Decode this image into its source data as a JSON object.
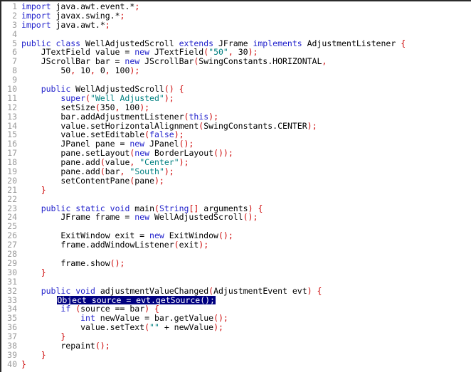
{
  "editor": {
    "language": "java",
    "total_lines": 40,
    "selected_line": 33,
    "colors": {
      "background": "#ffffff",
      "text": "#000000",
      "keyword": "#2222cc",
      "string": "#008080",
      "punctuation": "#cc0000",
      "line_number": "#9a9a9a",
      "selection_background": "#000080",
      "selection_text": "#ffffff",
      "border": "#2b2b2b"
    }
  },
  "lines": [
    {
      "n": "1",
      "tokens": [
        {
          "t": "kw",
          "v": "import"
        },
        {
          "t": "id",
          "v": " java"
        },
        {
          "t": "id",
          "v": "."
        },
        {
          "t": "id",
          "v": "awt"
        },
        {
          "t": "id",
          "v": "."
        },
        {
          "t": "id",
          "v": "event"
        },
        {
          "t": "id",
          "v": ".*"
        },
        {
          "t": "pun",
          "v": ";"
        }
      ]
    },
    {
      "n": "2",
      "tokens": [
        {
          "t": "kw",
          "v": "import"
        },
        {
          "t": "id",
          "v": " javax"
        },
        {
          "t": "id",
          "v": "."
        },
        {
          "t": "id",
          "v": "swing"
        },
        {
          "t": "id",
          "v": ".*"
        },
        {
          "t": "pun",
          "v": ";"
        }
      ]
    },
    {
      "n": "3",
      "tokens": [
        {
          "t": "kw",
          "v": "import"
        },
        {
          "t": "id",
          "v": " java"
        },
        {
          "t": "id",
          "v": "."
        },
        {
          "t": "id",
          "v": "awt"
        },
        {
          "t": "id",
          "v": ".*"
        },
        {
          "t": "pun",
          "v": ";"
        }
      ]
    },
    {
      "n": "4",
      "tokens": []
    },
    {
      "n": "5",
      "tokens": [
        {
          "t": "kw",
          "v": "public"
        },
        {
          "t": "id",
          "v": " "
        },
        {
          "t": "kw",
          "v": "class"
        },
        {
          "t": "id",
          "v": " WellAdjustedScroll "
        },
        {
          "t": "kw",
          "v": "extends"
        },
        {
          "t": "id",
          "v": " JFrame "
        },
        {
          "t": "kw",
          "v": "implements"
        },
        {
          "t": "id",
          "v": " AdjustmentListener "
        },
        {
          "t": "pun",
          "v": "{"
        }
      ]
    },
    {
      "n": "6",
      "tokens": [
        {
          "t": "id",
          "v": "    JTextField value = "
        },
        {
          "t": "kw",
          "v": "new"
        },
        {
          "t": "id",
          "v": " JTextField"
        },
        {
          "t": "pun",
          "v": "("
        },
        {
          "t": "str",
          "v": "\"50\""
        },
        {
          "t": "pun",
          "v": ","
        },
        {
          "t": "id",
          "v": " 30"
        },
        {
          "t": "pun",
          "v": ");"
        }
      ]
    },
    {
      "n": "7",
      "tokens": [
        {
          "t": "id",
          "v": "    JScrollBar bar = "
        },
        {
          "t": "kw",
          "v": "new"
        },
        {
          "t": "id",
          "v": " JScrollBar"
        },
        {
          "t": "pun",
          "v": "("
        },
        {
          "t": "id",
          "v": "SwingConstants"
        },
        {
          "t": "id",
          "v": "."
        },
        {
          "t": "id",
          "v": "HORIZONTAL"
        },
        {
          "t": "pun",
          "v": ","
        }
      ]
    },
    {
      "n": "8",
      "tokens": [
        {
          "t": "id",
          "v": "        50"
        },
        {
          "t": "pun",
          "v": ","
        },
        {
          "t": "id",
          "v": " 10"
        },
        {
          "t": "pun",
          "v": ","
        },
        {
          "t": "id",
          "v": " 0"
        },
        {
          "t": "pun",
          "v": ","
        },
        {
          "t": "id",
          "v": " 100"
        },
        {
          "t": "pun",
          "v": ");"
        }
      ]
    },
    {
      "n": "9",
      "tokens": []
    },
    {
      "n": "10",
      "tokens": [
        {
          "t": "id",
          "v": "    "
        },
        {
          "t": "kw",
          "v": "public"
        },
        {
          "t": "id",
          "v": " WellAdjustedScroll"
        },
        {
          "t": "pun",
          "v": "()"
        },
        {
          "t": "id",
          "v": " "
        },
        {
          "t": "pun",
          "v": "{"
        }
      ]
    },
    {
      "n": "11",
      "tokens": [
        {
          "t": "id",
          "v": "        "
        },
        {
          "t": "kw",
          "v": "super"
        },
        {
          "t": "pun",
          "v": "("
        },
        {
          "t": "str",
          "v": "\"Well Adjusted\""
        },
        {
          "t": "pun",
          "v": ");"
        }
      ]
    },
    {
      "n": "12",
      "tokens": [
        {
          "t": "id",
          "v": "        setSize"
        },
        {
          "t": "pun",
          "v": "("
        },
        {
          "t": "id",
          "v": "350"
        },
        {
          "t": "pun",
          "v": ","
        },
        {
          "t": "id",
          "v": " 100"
        },
        {
          "t": "pun",
          "v": ");"
        }
      ]
    },
    {
      "n": "13",
      "tokens": [
        {
          "t": "id",
          "v": "        bar"
        },
        {
          "t": "id",
          "v": "."
        },
        {
          "t": "id",
          "v": "addAdjustmentListener"
        },
        {
          "t": "pun",
          "v": "("
        },
        {
          "t": "kw",
          "v": "this"
        },
        {
          "t": "pun",
          "v": ");"
        }
      ]
    },
    {
      "n": "14",
      "tokens": [
        {
          "t": "id",
          "v": "        value"
        },
        {
          "t": "id",
          "v": "."
        },
        {
          "t": "id",
          "v": "setHorizontalAlignment"
        },
        {
          "t": "pun",
          "v": "("
        },
        {
          "t": "id",
          "v": "SwingConstants"
        },
        {
          "t": "id",
          "v": "."
        },
        {
          "t": "id",
          "v": "CENTER"
        },
        {
          "t": "pun",
          "v": ");"
        }
      ]
    },
    {
      "n": "15",
      "tokens": [
        {
          "t": "id",
          "v": "        value"
        },
        {
          "t": "id",
          "v": "."
        },
        {
          "t": "id",
          "v": "setEditable"
        },
        {
          "t": "pun",
          "v": "("
        },
        {
          "t": "kw",
          "v": "false"
        },
        {
          "t": "pun",
          "v": ");"
        }
      ]
    },
    {
      "n": "16",
      "tokens": [
        {
          "t": "id",
          "v": "        JPanel pane = "
        },
        {
          "t": "kw",
          "v": "new"
        },
        {
          "t": "id",
          "v": " JPanel"
        },
        {
          "t": "pun",
          "v": "();"
        }
      ]
    },
    {
      "n": "17",
      "tokens": [
        {
          "t": "id",
          "v": "        pane"
        },
        {
          "t": "id",
          "v": "."
        },
        {
          "t": "id",
          "v": "setLayout"
        },
        {
          "t": "pun",
          "v": "("
        },
        {
          "t": "kw",
          "v": "new"
        },
        {
          "t": "id",
          "v": " BorderLayout"
        },
        {
          "t": "pun",
          "v": "());"
        }
      ]
    },
    {
      "n": "18",
      "tokens": [
        {
          "t": "id",
          "v": "        pane"
        },
        {
          "t": "id",
          "v": "."
        },
        {
          "t": "id",
          "v": "add"
        },
        {
          "t": "pun",
          "v": "("
        },
        {
          "t": "id",
          "v": "value"
        },
        {
          "t": "pun",
          "v": ","
        },
        {
          "t": "id",
          "v": " "
        },
        {
          "t": "str",
          "v": "\"Center\""
        },
        {
          "t": "pun",
          "v": ");"
        }
      ]
    },
    {
      "n": "19",
      "tokens": [
        {
          "t": "id",
          "v": "        pane"
        },
        {
          "t": "id",
          "v": "."
        },
        {
          "t": "id",
          "v": "add"
        },
        {
          "t": "pun",
          "v": "("
        },
        {
          "t": "id",
          "v": "bar"
        },
        {
          "t": "pun",
          "v": ","
        },
        {
          "t": "id",
          "v": " "
        },
        {
          "t": "str",
          "v": "\"South\""
        },
        {
          "t": "pun",
          "v": ");"
        }
      ]
    },
    {
      "n": "20",
      "tokens": [
        {
          "t": "id",
          "v": "        setContentPane"
        },
        {
          "t": "pun",
          "v": "("
        },
        {
          "t": "id",
          "v": "pane"
        },
        {
          "t": "pun",
          "v": ");"
        }
      ]
    },
    {
      "n": "21",
      "tokens": [
        {
          "t": "id",
          "v": "    "
        },
        {
          "t": "pun",
          "v": "}"
        }
      ]
    },
    {
      "n": "22",
      "tokens": []
    },
    {
      "n": "23",
      "tokens": [
        {
          "t": "id",
          "v": "    "
        },
        {
          "t": "kw",
          "v": "public"
        },
        {
          "t": "id",
          "v": " "
        },
        {
          "t": "kw",
          "v": "static"
        },
        {
          "t": "id",
          "v": " "
        },
        {
          "t": "kw",
          "v": "void"
        },
        {
          "t": "id",
          "v": " main"
        },
        {
          "t": "pun",
          "v": "("
        },
        {
          "t": "kw",
          "v": "String"
        },
        {
          "t": "pun",
          "v": "[]"
        },
        {
          "t": "id",
          "v": " arguments"
        },
        {
          "t": "pun",
          "v": ")"
        },
        {
          "t": "id",
          "v": " "
        },
        {
          "t": "pun",
          "v": "{"
        }
      ]
    },
    {
      "n": "24",
      "tokens": [
        {
          "t": "id",
          "v": "        JFrame frame = "
        },
        {
          "t": "kw",
          "v": "new"
        },
        {
          "t": "id",
          "v": " WellAdjustedScroll"
        },
        {
          "t": "pun",
          "v": "();"
        }
      ]
    },
    {
      "n": "25",
      "tokens": []
    },
    {
      "n": "26",
      "tokens": [
        {
          "t": "id",
          "v": "        ExitWindow exit = "
        },
        {
          "t": "kw",
          "v": "new"
        },
        {
          "t": "id",
          "v": " ExitWindow"
        },
        {
          "t": "pun",
          "v": "();"
        }
      ]
    },
    {
      "n": "27",
      "tokens": [
        {
          "t": "id",
          "v": "        frame"
        },
        {
          "t": "id",
          "v": "."
        },
        {
          "t": "id",
          "v": "addWindowListener"
        },
        {
          "t": "pun",
          "v": "("
        },
        {
          "t": "id",
          "v": "exit"
        },
        {
          "t": "pun",
          "v": ");"
        }
      ]
    },
    {
      "n": "28",
      "tokens": []
    },
    {
      "n": "29",
      "tokens": [
        {
          "t": "id",
          "v": "        frame"
        },
        {
          "t": "id",
          "v": "."
        },
        {
          "t": "id",
          "v": "show"
        },
        {
          "t": "pun",
          "v": "();"
        }
      ]
    },
    {
      "n": "30",
      "tokens": [
        {
          "t": "id",
          "v": "    "
        },
        {
          "t": "pun",
          "v": "}"
        }
      ]
    },
    {
      "n": "31",
      "tokens": []
    },
    {
      "n": "32",
      "tokens": [
        {
          "t": "id",
          "v": "    "
        },
        {
          "t": "kw",
          "v": "public"
        },
        {
          "t": "id",
          "v": " "
        },
        {
          "t": "kw",
          "v": "void"
        },
        {
          "t": "id",
          "v": " adjustmentValueChanged"
        },
        {
          "t": "pun",
          "v": "("
        },
        {
          "t": "id",
          "v": "AdjustmentEvent evt"
        },
        {
          "t": "pun",
          "v": ")"
        },
        {
          "t": "id",
          "v": " "
        },
        {
          "t": "pun",
          "v": "{"
        }
      ]
    },
    {
      "n": "33",
      "selected": true,
      "indent": 8,
      "tokens": [
        {
          "t": "id",
          "v": "Object source = evt"
        },
        {
          "t": "id",
          "v": "."
        },
        {
          "t": "id",
          "v": "getSource"
        },
        {
          "t": "pun",
          "v": "();"
        }
      ]
    },
    {
      "n": "34",
      "tokens": [
        {
          "t": "id",
          "v": "        "
        },
        {
          "t": "kw",
          "v": "if"
        },
        {
          "t": "id",
          "v": " "
        },
        {
          "t": "pun",
          "v": "("
        },
        {
          "t": "id",
          "v": "source == bar"
        },
        {
          "t": "pun",
          "v": ")"
        },
        {
          "t": "id",
          "v": " "
        },
        {
          "t": "pun",
          "v": "{"
        }
      ]
    },
    {
      "n": "35",
      "tokens": [
        {
          "t": "id",
          "v": "            "
        },
        {
          "t": "kw",
          "v": "int"
        },
        {
          "t": "id",
          "v": " newValue = bar"
        },
        {
          "t": "id",
          "v": "."
        },
        {
          "t": "id",
          "v": "getValue"
        },
        {
          "t": "pun",
          "v": "();"
        }
      ]
    },
    {
      "n": "36",
      "tokens": [
        {
          "t": "id",
          "v": "            value"
        },
        {
          "t": "id",
          "v": "."
        },
        {
          "t": "id",
          "v": "setText"
        },
        {
          "t": "pun",
          "v": "("
        },
        {
          "t": "str",
          "v": "\"\""
        },
        {
          "t": "id",
          "v": " + newValue"
        },
        {
          "t": "pun",
          "v": ");"
        }
      ]
    },
    {
      "n": "37",
      "tokens": [
        {
          "t": "id",
          "v": "        "
        },
        {
          "t": "pun",
          "v": "}"
        }
      ]
    },
    {
      "n": "38",
      "tokens": [
        {
          "t": "id",
          "v": "        repaint"
        },
        {
          "t": "pun",
          "v": "();"
        }
      ]
    },
    {
      "n": "39",
      "tokens": [
        {
          "t": "id",
          "v": "    "
        },
        {
          "t": "pun",
          "v": "}"
        }
      ]
    },
    {
      "n": "40",
      "tokens": [
        {
          "t": "pun",
          "v": "}"
        }
      ]
    }
  ]
}
